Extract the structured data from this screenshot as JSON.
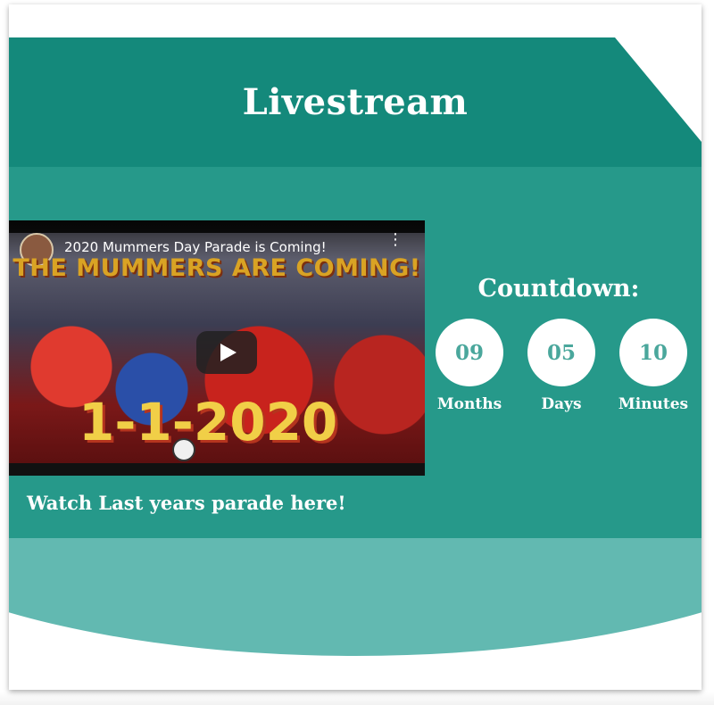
{
  "header": {
    "title": "Livestream"
  },
  "video": {
    "title": "2020 Mummers Day Parade is Coming!",
    "banner_text": "THE MUMMERS ARE COMING!",
    "date_text": "1-1-2020"
  },
  "caption": "Watch Last years parade here!",
  "countdown": {
    "title": "Countdown:",
    "items": [
      {
        "value": "09",
        "label": "Months"
      },
      {
        "value": "05",
        "label": "Days"
      },
      {
        "value": "10",
        "label": "Minutes"
      }
    ]
  },
  "colors": {
    "header": "#14897b",
    "main": "#26998a",
    "arc": "#62b9b1",
    "circle_text": "#4aa79c"
  }
}
